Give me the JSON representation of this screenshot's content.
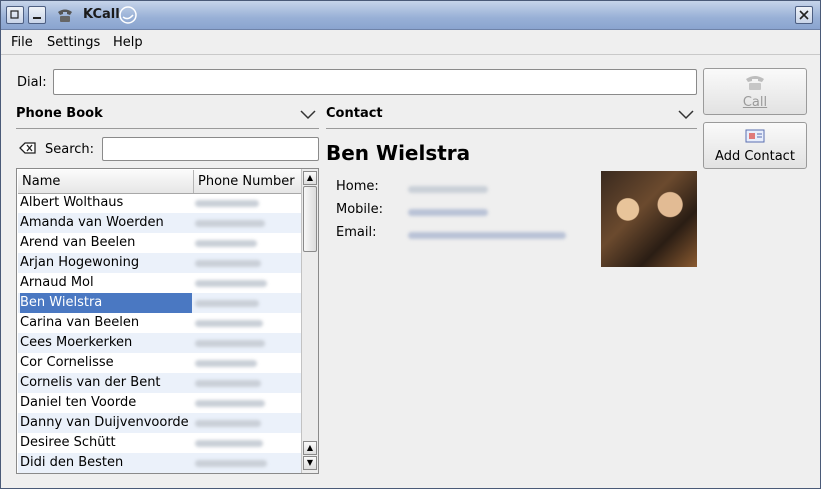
{
  "window": {
    "title": "KCall"
  },
  "menu": {
    "file": "File",
    "settings": "Settings",
    "help": "Help"
  },
  "dial": {
    "label": "Dial:",
    "value": ""
  },
  "call_button": {
    "label": "Call"
  },
  "add_contact_button": {
    "label": "Add Contact"
  },
  "phonebook": {
    "title": "Phone Book",
    "search_label": "Search:",
    "search_value": "",
    "columns": [
      "Name",
      "Phone Number"
    ],
    "rows": [
      {
        "name": "Albert Wolthaus",
        "selected": false
      },
      {
        "name": "Amanda van Woerden",
        "selected": false
      },
      {
        "name": "Arend van Beelen",
        "selected": false
      },
      {
        "name": "Arjan Hogewoning",
        "selected": false
      },
      {
        "name": "Arnaud Mol",
        "selected": false
      },
      {
        "name": "Ben Wielstra",
        "selected": true
      },
      {
        "name": "Carina van Beelen",
        "selected": false
      },
      {
        "name": "Cees Moerkerken",
        "selected": false
      },
      {
        "name": "Cor Cornelisse",
        "selected": false
      },
      {
        "name": "Cornelis van der Bent",
        "selected": false
      },
      {
        "name": "Daniel ten Voorde",
        "selected": false
      },
      {
        "name": "Danny van Duijvenvoorde",
        "selected": false
      },
      {
        "name": "Desiree Schütt",
        "selected": false
      },
      {
        "name": "Didi den Besten",
        "selected": false
      }
    ]
  },
  "contact": {
    "title": "Contact",
    "name": "Ben Wielstra",
    "home_label": "Home:",
    "mobile_label": "Mobile:",
    "email_label": "Email:"
  }
}
